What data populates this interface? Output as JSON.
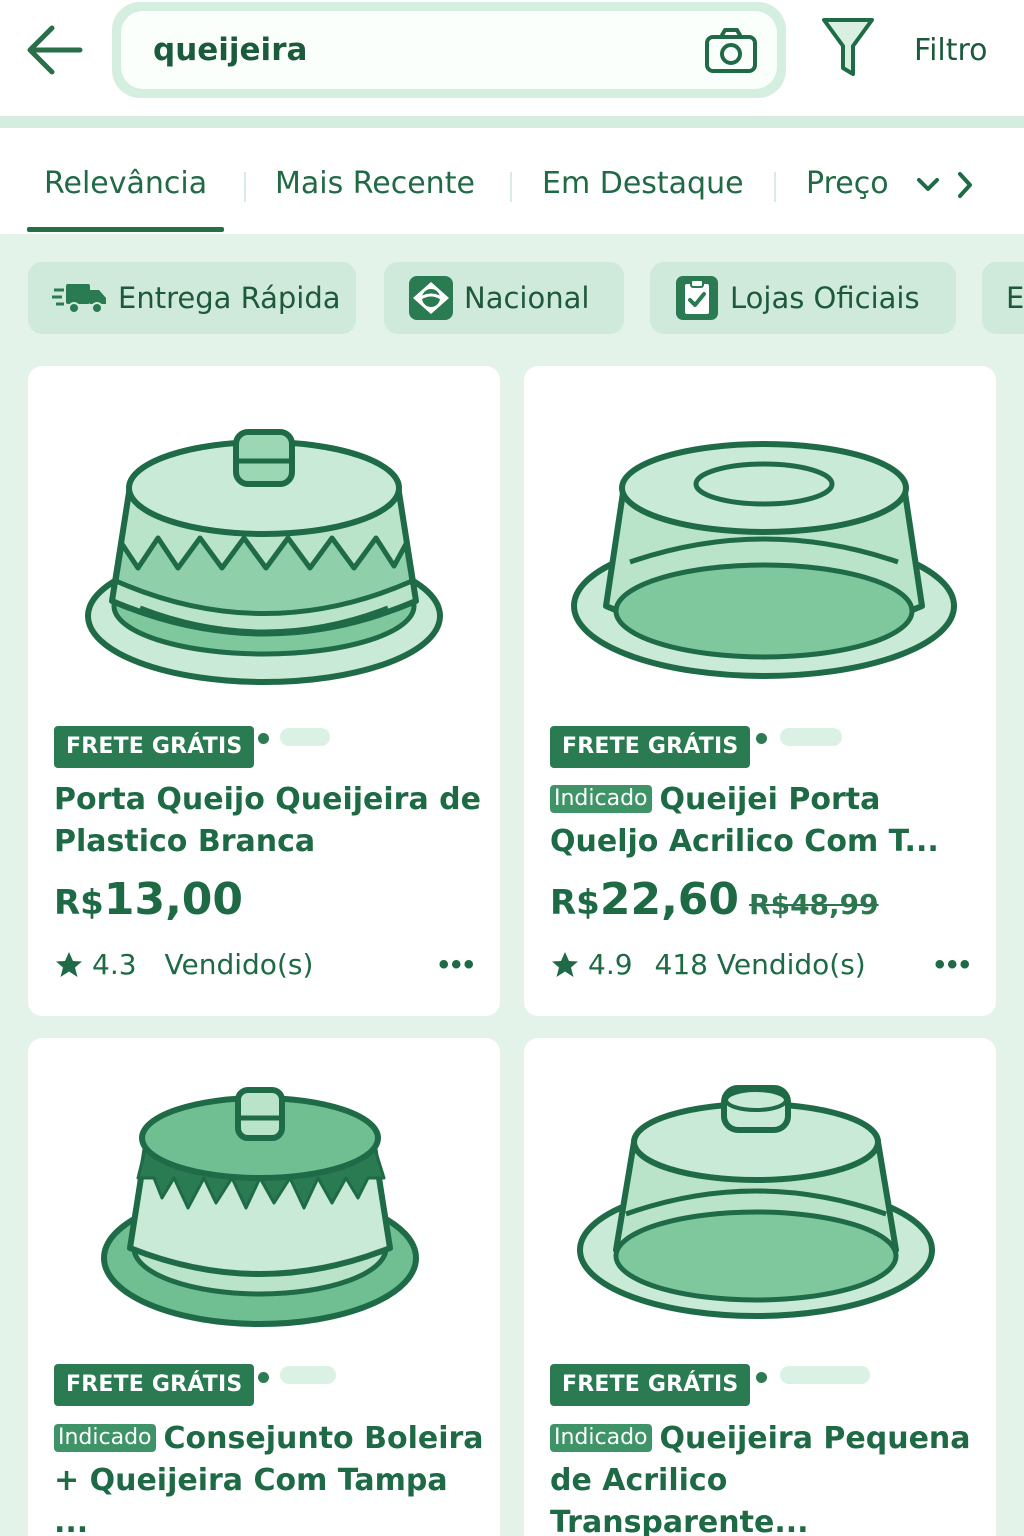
{
  "search": {
    "value": "queijeira"
  },
  "header": {
    "filter_label": "Filtro",
    "back_icon": "back-arrow-icon",
    "camera_icon": "camera-icon",
    "filter_icon": "funnel-icon"
  },
  "sort_tabs": [
    {
      "label": "Relevância",
      "active": true
    },
    {
      "label": "Mais Recente"
    },
    {
      "label": "Em Destaque"
    },
    {
      "label": "Preço"
    }
  ],
  "chips": [
    {
      "label": "Entrega Rápida",
      "icon": "delivery-truck-icon"
    },
    {
      "label": "Nacional",
      "icon": "brazil-flag-icon"
    },
    {
      "label": "Lojas Oficiais",
      "icon": "clipboard-check-icon"
    },
    {
      "label": "E"
    }
  ],
  "products": [
    {
      "badge": "FRETE GRÁTIS",
      "title": "Porta Queijo Queijeira de Plastico Branca",
      "currency": "R$",
      "price": "13,00",
      "rating": "4.3",
      "sold": "Vendido(s)"
    },
    {
      "badge": "FRETE GRÁTIS",
      "tag": "Indicado",
      "title": "Queijei Porta Queljo Acrilico Com T...",
      "currency": "R$",
      "price": "22,60",
      "old_price": "R$48,99",
      "rating": "4.9",
      "sold": "418 Vendido(s)"
    },
    {
      "badge": "FRETE GRÁTIS",
      "tag": "Indicado",
      "title": "Consejunto Boleira + Queijeira Com Tampa ..."
    },
    {
      "badge": "FRETE GRÁTIS",
      "tag": "Indicado",
      "title": "Queijeira Pequena de Acrilico Transparente..."
    }
  ],
  "colors": {
    "primary": "#1f6b47",
    "badge": "#2a7a52",
    "background": "#e4f3ea",
    "chip": "#cfeadb"
  }
}
